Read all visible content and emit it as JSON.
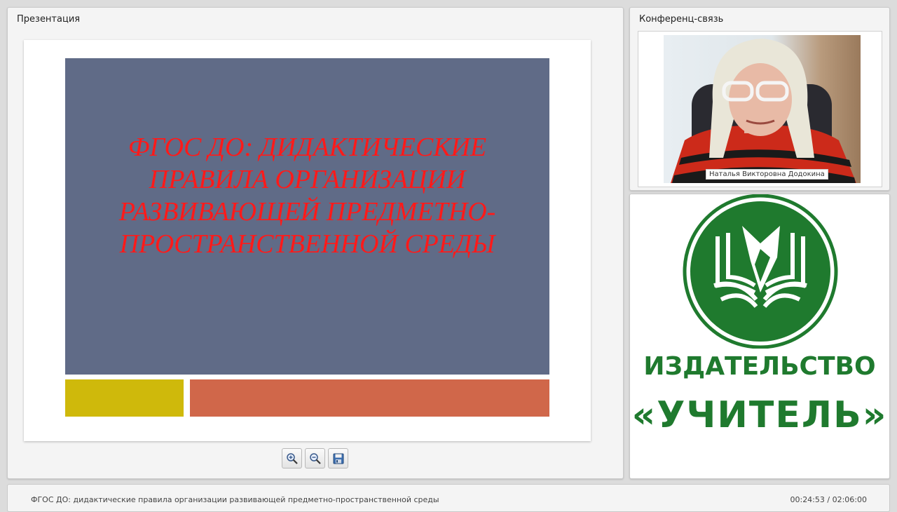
{
  "presentation": {
    "title": "Презентация",
    "slide_title": "ФГОС ДО: ДИДАКТИЧЕСКИЕ ПРАВИЛА ОРГАНИЗАЦИИ РАЗВИВАЮЩЕЙ ПРЕДМЕТНО-ПРОСТРАНСТВЕННОЙ СРЕДЫ",
    "colors": {
      "slide_bg": "#606b87",
      "slide_title": "#ff1a1a",
      "accent_yellow": "#cfb90b",
      "accent_orange": "#d0674a"
    },
    "toolbar": [
      {
        "icon": "zoom-in-icon"
      },
      {
        "icon": "zoom-out-icon"
      },
      {
        "icon": "save-icon"
      }
    ]
  },
  "conference": {
    "title": "Конференц-связь",
    "speaker_name": "Наталья Викторовна Додокина"
  },
  "logo": {
    "line1": "ИЗДАТЕЛЬСТВО",
    "line2": "«УЧИТЕЛЬ»",
    "color": "#1f7a2e"
  },
  "status": {
    "title": "ФГОС ДО: дидактические правила организации развивающей предметно-пространственной среды",
    "time": "00:24:53 / 02:06:00"
  }
}
